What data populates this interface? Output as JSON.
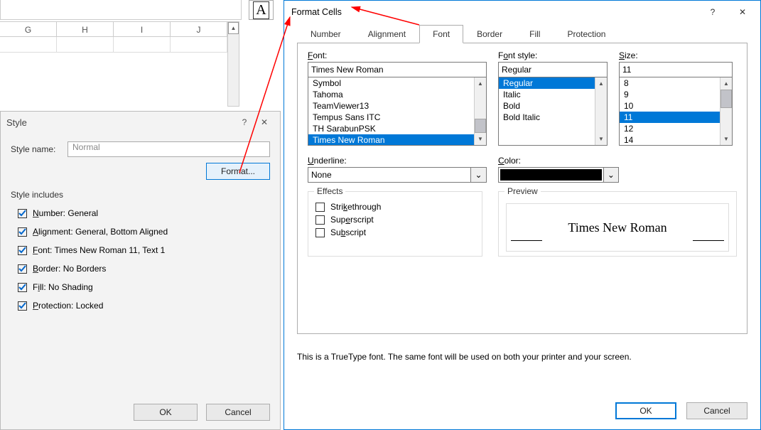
{
  "sheet": {
    "cols": [
      "G",
      "H",
      "I",
      "J"
    ],
    "floating": "A"
  },
  "styleDialog": {
    "title": "Style",
    "styleNameLabel": "Style name:",
    "styleNameValue": "Normal",
    "formatBtn": "Format...",
    "includesLabel": "Style includes",
    "items": [
      {
        "u": "N",
        "rest": "umber: General"
      },
      {
        "u": "A",
        "rest": "lignment: General, Bottom Aligned"
      },
      {
        "u": "F",
        "rest": "ont: Times New Roman 11, Text 1"
      },
      {
        "u": "B",
        "rest": "order: No Borders"
      },
      {
        "u": "F",
        "prefix": "",
        "label": "Fill: No Shading",
        "uIdx": 0,
        "text": "Fill: No Shading",
        "underChar": "i",
        "before": "F",
        "after": "ll: No Shading"
      },
      {
        "u": "P",
        "rest": "rotection: Locked"
      }
    ],
    "ok": "OK",
    "cancel": "Cancel"
  },
  "fc": {
    "title": "Format Cells",
    "tabs": [
      "Number",
      "Alignment",
      "Font",
      "Border",
      "Fill",
      "Protection"
    ],
    "activeTab": 2,
    "fontLabel": "Font:",
    "fontValue": "Times New Roman",
    "fontList": [
      "Symbol",
      "Tahoma",
      "TeamViewer13",
      "Tempus Sans ITC",
      "TH SarabunPSK",
      "Times New Roman"
    ],
    "fontSelected": 5,
    "styleLabel": "Font style:",
    "styleValue": "Regular",
    "styleList": [
      "Regular",
      "Italic",
      "Bold",
      "Bold Italic"
    ],
    "styleSelected": 0,
    "sizeLabel": "Size:",
    "sizeValue": "11",
    "sizeList": [
      "8",
      "9",
      "10",
      "11",
      "12",
      "14"
    ],
    "sizeSelected": 3,
    "underlineLabel": "Underline:",
    "underlineValue": "None",
    "colorLabel": "Color:",
    "colorValue": "#000000",
    "effectsLabel": "Effects",
    "effects": [
      "Strikethrough",
      "Superscript",
      "Subscript"
    ],
    "previewLabel": "Preview",
    "previewText": "Times New Roman",
    "info": "This is a TrueType font.  The same font will be used on both your printer and your screen.",
    "ok": "OK",
    "cancel": "Cancel"
  }
}
